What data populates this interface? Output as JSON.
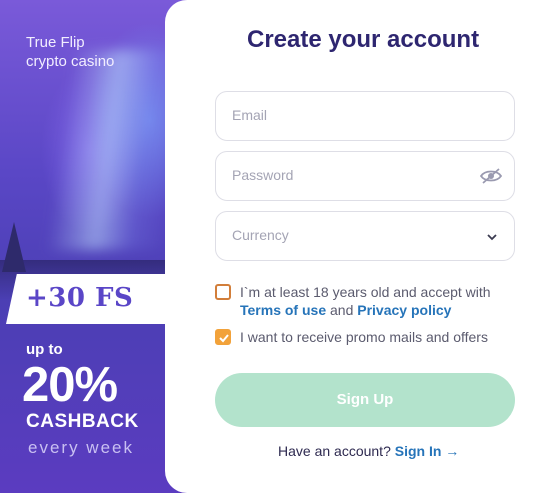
{
  "promo": {
    "brand_line1": "True Flip",
    "brand_line2": "crypto casino",
    "free_spins": "+30 FS",
    "up_to": "up to",
    "percent": "20%",
    "cashback": "CASHBACK",
    "every_week": "every week"
  },
  "form": {
    "title": "Create your account",
    "email_placeholder": "Email",
    "password_placeholder": "Password",
    "currency_placeholder": "Currency",
    "terms_text_1": "I`m at least 18 years old and accept with",
    "terms_link": "Terms of use",
    "terms_and": "and",
    "privacy_link": "Privacy policy",
    "promo_mails_text": "I want to receive promo mails and offers",
    "terms_checked": false,
    "promo_checked": true,
    "signup_label": "Sign Up",
    "have_account": "Have an account?",
    "signin_label": "Sign In →"
  },
  "colors": {
    "accent": "#2674b9",
    "title": "#2e2670",
    "signup_bg": "#b3e3cc",
    "checkbox_checked": "#f2a23a",
    "promo_bg": "#5a47c6"
  },
  "icons": [
    "eye-icon",
    "chevron-down-icon",
    "checkmark-icon",
    "arrow-right-icon"
  ]
}
